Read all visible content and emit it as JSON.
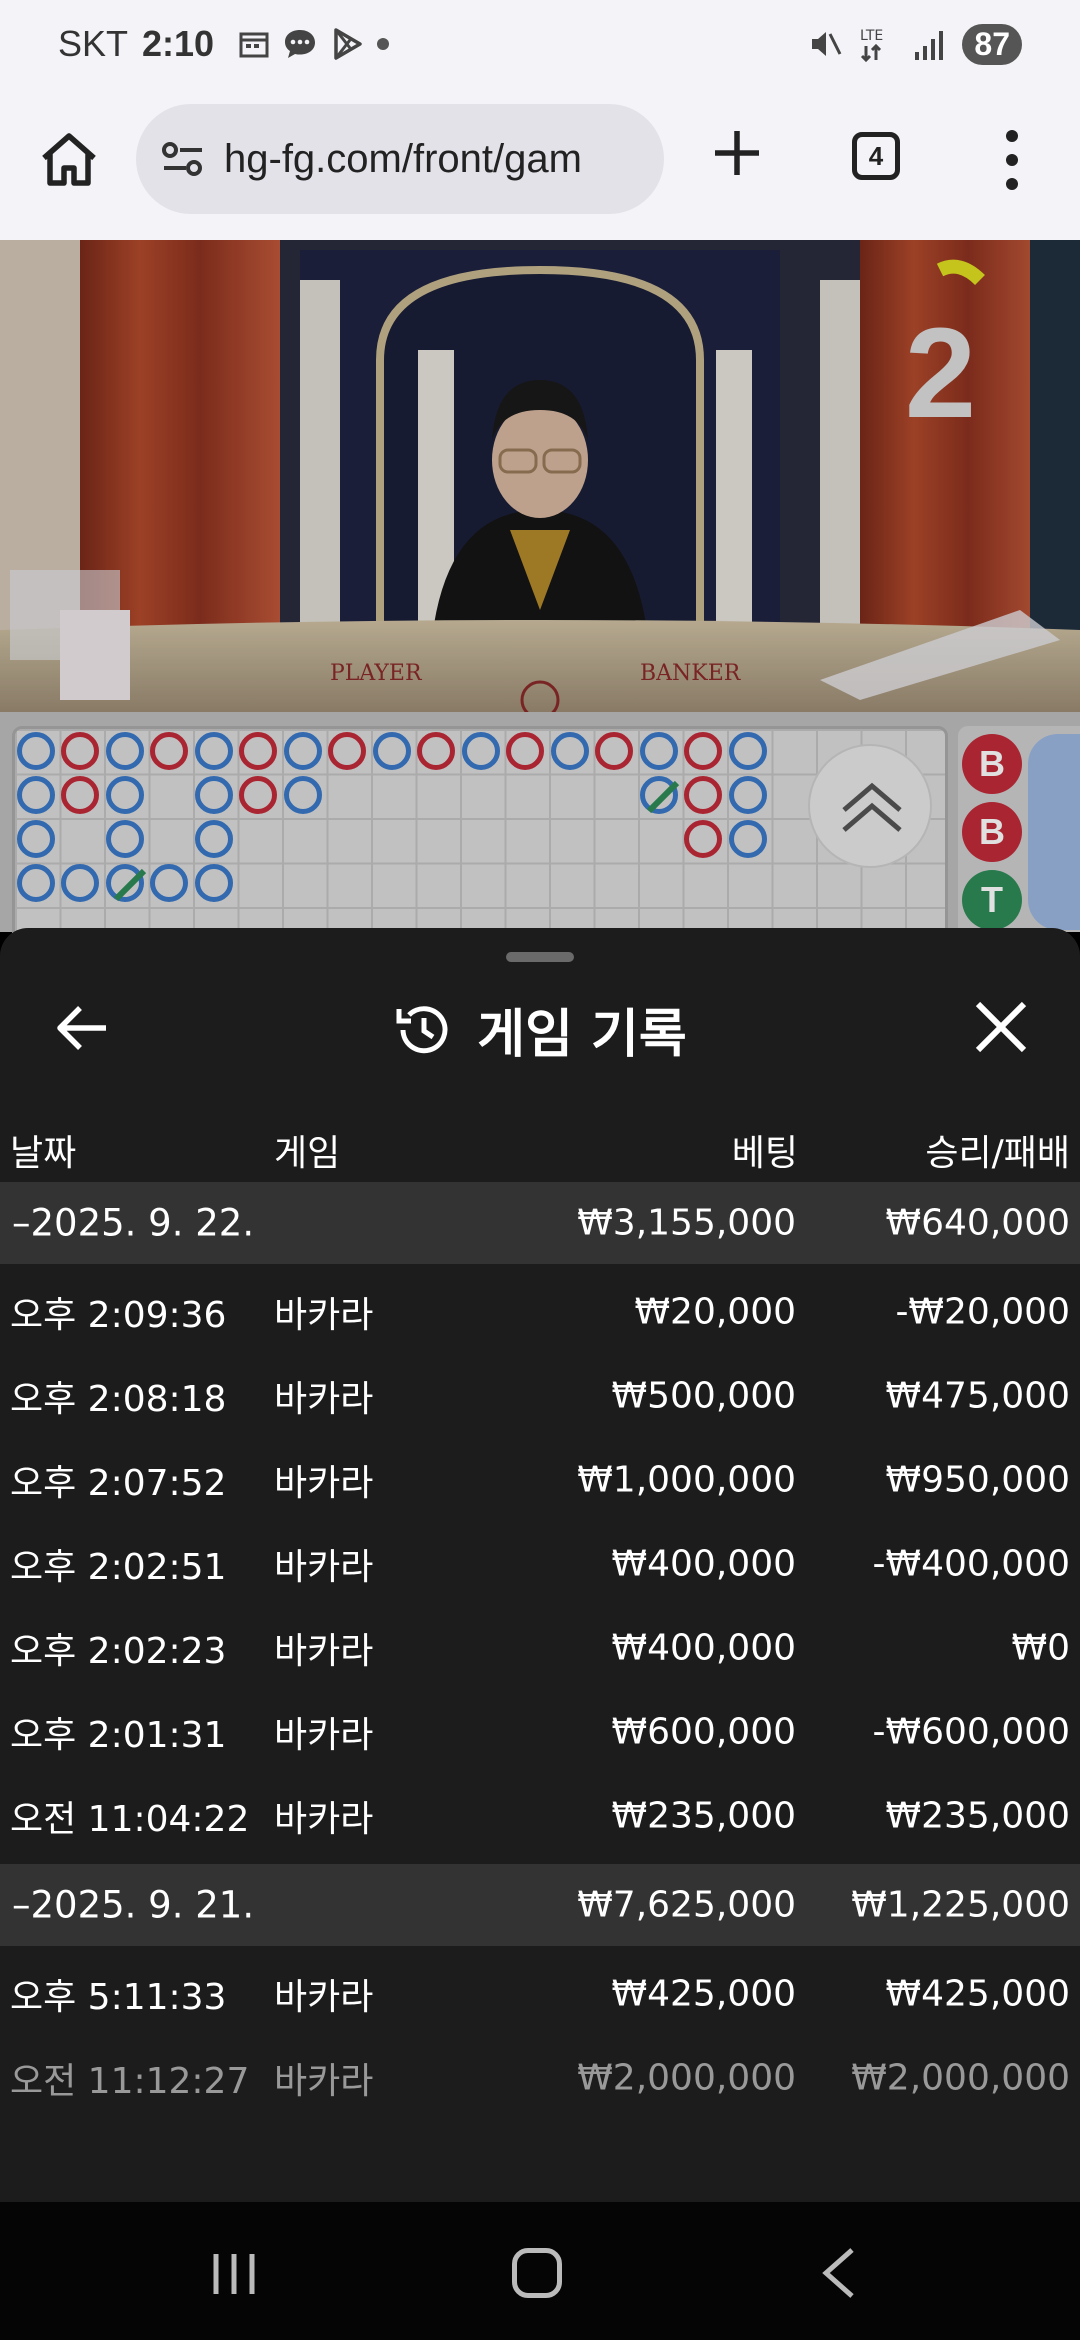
{
  "status_bar": {
    "carrier": "SKT",
    "time": "2:10",
    "network": "LTE",
    "battery": "87"
  },
  "browser": {
    "url": "hg-fg.com/front/gam",
    "tab_count": "4"
  },
  "game": {
    "countdown": "2",
    "table_labels": [
      "PLAYER",
      "BANKER"
    ],
    "side_badges": [
      "B",
      "B",
      "T"
    ]
  },
  "history_sheet": {
    "title": "게임 기록",
    "columns": {
      "date": "날짜",
      "game": "게임",
      "bet": "베팅",
      "result": "승리/패배"
    },
    "groups": [
      {
        "date": "–2025. 9. 22.",
        "bet_total": "₩3,155,000",
        "result_total": "₩640,000",
        "entries": [
          {
            "time": "오후 2:09:36",
            "game": "바카라",
            "bet": "₩20,000",
            "result": "-₩20,000"
          },
          {
            "time": "오후 2:08:18",
            "game": "바카라",
            "bet": "₩500,000",
            "result": "₩475,000"
          },
          {
            "time": "오후 2:07:52",
            "game": "바카라",
            "bet": "₩1,000,000",
            "result": "₩950,000"
          },
          {
            "time": "오후 2:02:51",
            "game": "바카라",
            "bet": "₩400,000",
            "result": "-₩400,000"
          },
          {
            "time": "오후 2:02:23",
            "game": "바카라",
            "bet": "₩400,000",
            "result": "₩0"
          },
          {
            "time": "오후 2:01:31",
            "game": "바카라",
            "bet": "₩600,000",
            "result": "-₩600,000"
          },
          {
            "time": "오전 11:04:22",
            "game": "바카라",
            "bet": "₩235,000",
            "result": "₩235,000"
          }
        ]
      },
      {
        "date": "–2025. 9. 21.",
        "bet_total": "₩7,625,000",
        "result_total": "₩1,225,000",
        "entries": [
          {
            "time": "오후 5:11:33",
            "game": "바카라",
            "bet": "₩425,000",
            "result": "₩425,000"
          },
          {
            "time": "오전 11:12:27",
            "game": "바카라",
            "bet": "₩2,000,000",
            "result": "₩2,000,000"
          }
        ]
      }
    ]
  },
  "colors": {
    "sheet_bg": "#1c1c1c",
    "group_row_bg": "#333333",
    "player_blue": "#3a78c8",
    "banker_red": "#c22b3a",
    "tie_green": "#2e8b57"
  }
}
